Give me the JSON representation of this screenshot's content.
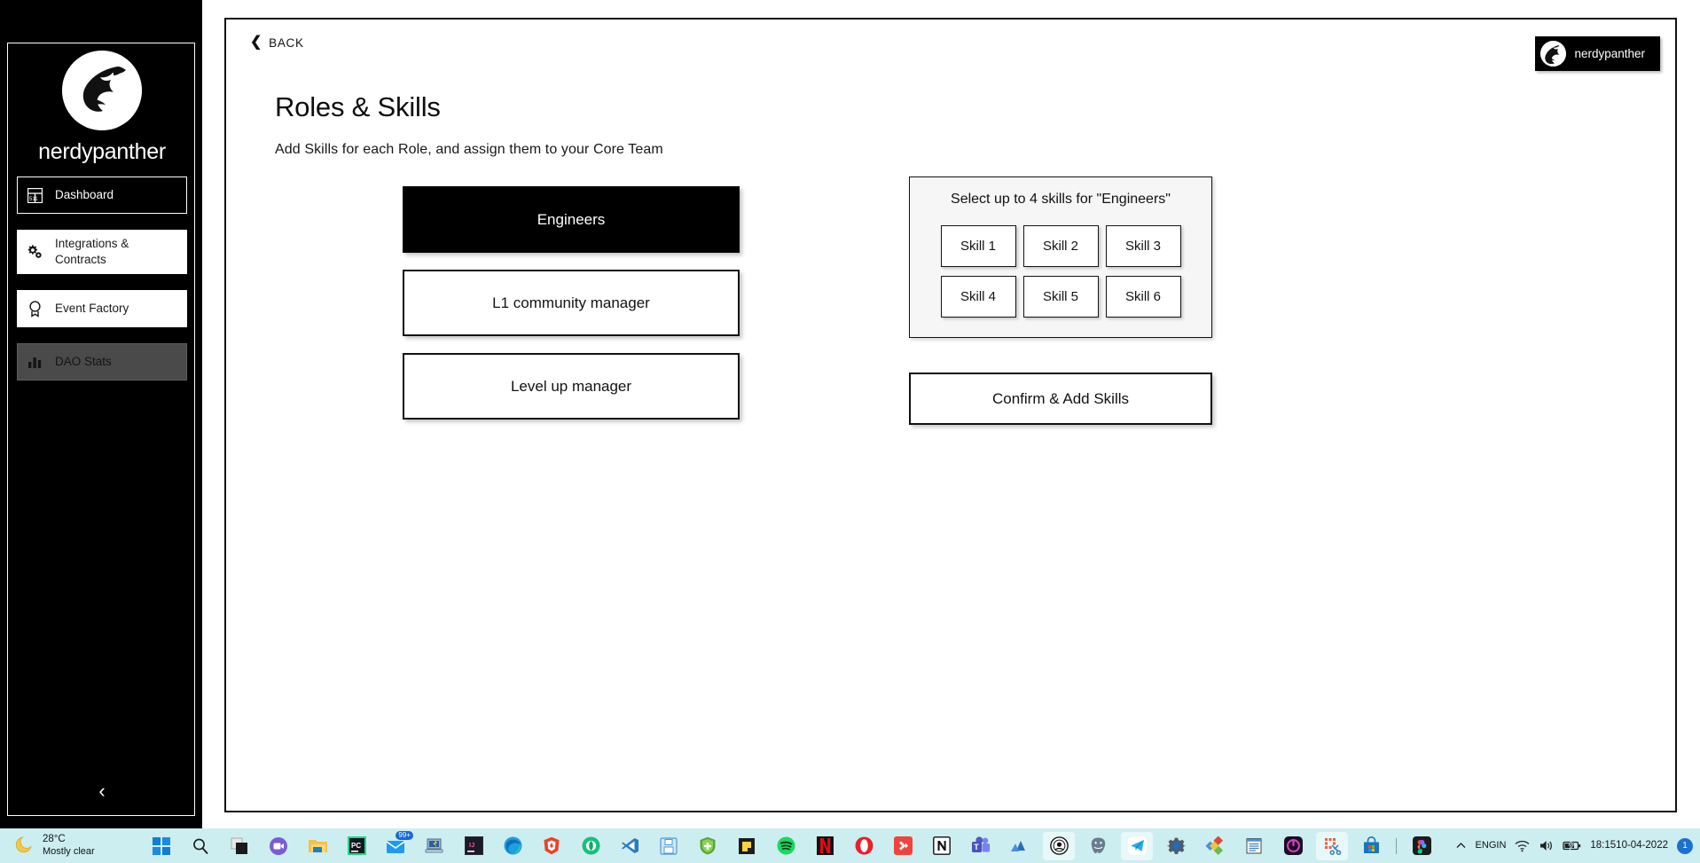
{
  "sidebar": {
    "brand": "nerdypanther",
    "logo_icon": "panther-logo-icon",
    "items": [
      {
        "label": "Dashboard",
        "icon": "dashboard-grid-icon",
        "state": "active"
      },
      {
        "label": "Integrations & Contracts",
        "icon": "gears-icon",
        "state": "plain"
      },
      {
        "label": "Event Factory",
        "icon": "award-badge-icon",
        "state": "plain"
      },
      {
        "label": "DAO Stats",
        "icon": "bar-chart-icon",
        "state": "disabled"
      }
    ],
    "collapse_icon": "chevron-left-icon"
  },
  "header": {
    "back_label": "BACK",
    "back_icon": "chevron-left-icon",
    "title": "Roles & Skills",
    "subtitle": "Add Skills for each Role, and assign them to your Core Team",
    "user_badge": {
      "name": "nerdypanther",
      "avatar_icon": "panther-avatar-icon"
    }
  },
  "roles": [
    {
      "label": "Engineers",
      "selected": true
    },
    {
      "label": "L1 community manager",
      "selected": false
    },
    {
      "label": "Level up manager",
      "selected": false
    }
  ],
  "skills_panel": {
    "heading": "Select up to 4 skills for \"Engineers\"",
    "skills": [
      {
        "label": "Skill 1"
      },
      {
        "label": "Skill 2"
      },
      {
        "label": "Skill 3"
      },
      {
        "label": "Skill 4"
      },
      {
        "label": "Skill 5"
      },
      {
        "label": "Skill 6"
      }
    ],
    "confirm_label": "Confirm & Add Skills"
  },
  "taskbar": {
    "weather": {
      "temperature": "28°C",
      "condition": "Mostly clear",
      "icon": "moon-icon"
    },
    "apps": [
      {
        "name": "start-windows-icon"
      },
      {
        "name": "search-icon"
      },
      {
        "name": "task-view-icon"
      },
      {
        "name": "chat-teams-icon"
      },
      {
        "name": "file-explorer-icon"
      },
      {
        "name": "pycharm-icon"
      },
      {
        "name": "mail-icon",
        "badge": "99+"
      },
      {
        "name": "remote-desktop-icon"
      },
      {
        "name": "intellij-idea-icon"
      },
      {
        "name": "microsoft-edge-icon"
      },
      {
        "name": "brave-browser-icon"
      },
      {
        "name": "opera-gx-icon"
      },
      {
        "name": "vs-code-icon"
      },
      {
        "name": "save-app-icon"
      },
      {
        "name": "shield-app-icon"
      },
      {
        "name": "sticky-notes-icon"
      },
      {
        "name": "spotify-icon"
      },
      {
        "name": "netflix-icon"
      },
      {
        "name": "opera-icon"
      },
      {
        "name": "anydesk-icon"
      },
      {
        "name": "notion-icon"
      },
      {
        "name": "microsoft-teams-icon"
      },
      {
        "name": "triangle-app-icon"
      },
      {
        "name": "coin-app-icon"
      },
      {
        "name": "postgresql-icon"
      },
      {
        "name": "telegram-icon"
      },
      {
        "name": "settings-gear-icon"
      },
      {
        "name": "colors-app-icon"
      },
      {
        "name": "notepad-icon"
      },
      {
        "name": "power-app-icon"
      },
      {
        "name": "snipping-tool-icon"
      },
      {
        "name": "microsoft-store-icon"
      },
      {
        "name": "figma-icon"
      }
    ],
    "tray": {
      "overflow_icon": "chevron-up-icon",
      "language_top": "ENG",
      "language_bottom": "IN",
      "wifi_icon": "wifi-icon",
      "volume_icon": "speaker-icon",
      "battery_icon": "battery-charging-icon",
      "time": "18:15",
      "date": "10-04-2022",
      "notification_count": "1"
    }
  },
  "colors": {
    "sidebar_bg": "#000000",
    "card_border": "#111111",
    "selected_role_bg": "#000000",
    "panel_bg": "#f6f6f6",
    "taskbar_bg": "#cdeef0",
    "accent_blue": "#1a72d0"
  }
}
